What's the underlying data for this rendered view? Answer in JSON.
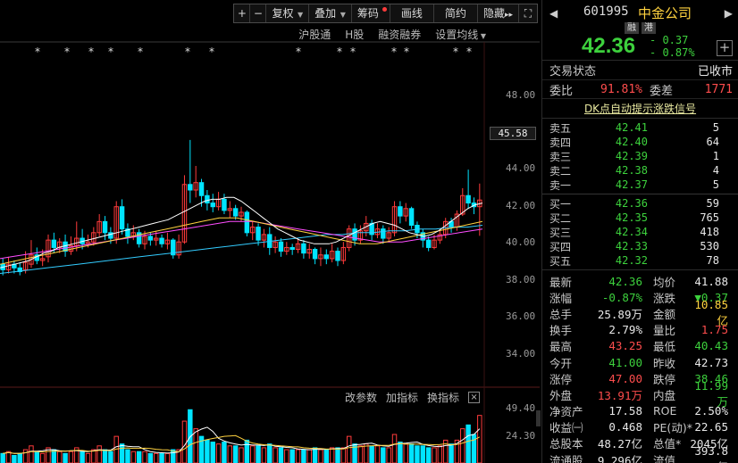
{
  "toolbar": {
    "plus": "+",
    "minus": "−",
    "fuquan": "复权",
    "diejia": "叠加",
    "chouma": "筹码",
    "huaxian": "画线",
    "jianyue": "简约",
    "yincang": "隐藏",
    "yincang_arrow": "▸▸",
    "fullscreen_icon": "⛶"
  },
  "subbar": {
    "hugutong": "沪股通",
    "hgu": "H股",
    "rongzi": "融资融券",
    "settings": "设置均线"
  },
  "price_axis": [
    "48.00",
    "45.58",
    "44.00",
    "42.00",
    "40.00",
    "38.00",
    "36.00",
    "34.00"
  ],
  "volume_axis": [
    "49.40",
    "24.30"
  ],
  "current_price_tag": "45.58",
  "indicator_bar": {
    "change_params": "改参数",
    "add_indicator": "加指标",
    "switch_indicator": "换指标",
    "close_icon": "×"
  },
  "colors": {
    "up": "#ff3b3b",
    "down": "#00e4ff",
    "ma5": "#ffffff",
    "ma10": "#ffd23f",
    "ma20": "#ff4dff",
    "ma30": "#33dd33",
    "ma60": "#33ccff",
    "ma120": "#aaaaaa"
  },
  "chart_data": {
    "type": "candlestick",
    "ylim": [
      33.5,
      49.5
    ],
    "candles": [
      [
        38.9,
        38.6,
        39.2,
        38.3
      ],
      [
        38.6,
        38.9,
        39.3,
        38.4
      ],
      [
        38.9,
        38.7,
        39.1,
        38.4
      ],
      [
        38.7,
        38.5,
        39.0,
        38.3
      ],
      [
        38.6,
        39.0,
        39.6,
        38.4
      ],
      [
        38.9,
        39.4,
        40.2,
        38.7
      ],
      [
        39.4,
        39.1,
        39.8,
        38.9
      ],
      [
        39.1,
        39.2,
        39.7,
        38.8
      ],
      [
        39.3,
        40.2,
        40.5,
        39.0
      ],
      [
        40.2,
        39.8,
        40.6,
        39.5
      ],
      [
        39.8,
        40.1,
        40.3,
        39.5
      ],
      [
        40.1,
        39.6,
        40.5,
        39.3
      ],
      [
        39.6,
        39.9,
        40.4,
        39.4
      ],
      [
        39.9,
        40.3,
        41.2,
        39.6
      ],
      [
        40.3,
        40.0,
        40.8,
        39.7
      ],
      [
        40.0,
        40.1,
        40.5,
        39.8
      ],
      [
        40.1,
        40.6,
        40.9,
        39.9
      ],
      [
        40.6,
        41.2,
        41.6,
        40.4
      ],
      [
        41.2,
        40.6,
        41.5,
        40.2
      ],
      [
        40.6,
        40.3,
        40.9,
        40.0
      ],
      [
        40.3,
        42.0,
        42.3,
        40.0
      ],
      [
        42.0,
        40.8,
        42.4,
        40.5
      ],
      [
        40.8,
        40.4,
        41.1,
        40.0
      ],
      [
        40.4,
        40.6,
        41.0,
        40.2
      ],
      [
        40.6,
        40.0,
        40.8,
        39.8
      ],
      [
        40.0,
        40.4,
        40.7,
        39.7
      ],
      [
        40.4,
        40.2,
        40.6,
        39.9
      ],
      [
        40.2,
        40.3,
        40.7,
        39.9
      ],
      [
        40.3,
        40.0,
        40.5,
        39.8
      ],
      [
        40.0,
        40.2,
        40.6,
        39.7
      ],
      [
        40.2,
        39.4,
        40.3,
        39.2
      ],
      [
        39.4,
        40.1,
        40.5,
        39.2
      ],
      [
        40.1,
        43.2,
        43.7,
        40.0
      ],
      [
        43.2,
        42.9,
        45.6,
        42.2
      ],
      [
        42.9,
        43.3,
        44.2,
        42.5
      ],
      [
        43.3,
        42.6,
        43.5,
        42.0
      ],
      [
        42.6,
        42.2,
        42.9,
        41.8
      ],
      [
        42.2,
        42.0,
        42.7,
        41.7
      ],
      [
        42.0,
        42.4,
        42.8,
        41.8
      ],
      [
        42.4,
        41.8,
        42.7,
        41.6
      ],
      [
        41.8,
        41.9,
        42.3,
        41.4
      ],
      [
        41.9,
        41.5,
        42.1,
        41.3
      ],
      [
        41.5,
        41.7,
        42.0,
        41.2
      ],
      [
        41.7,
        40.6,
        41.8,
        40.4
      ],
      [
        40.6,
        40.9,
        41.2,
        40.2
      ],
      [
        40.9,
        40.2,
        41.1,
        39.9
      ],
      [
        40.2,
        40.5,
        40.8,
        39.8
      ],
      [
        40.5,
        39.8,
        40.9,
        39.4
      ],
      [
        39.8,
        40.1,
        40.4,
        39.5
      ],
      [
        40.1,
        39.6,
        40.3,
        39.3
      ],
      [
        39.6,
        39.8,
        40.1,
        39.4
      ],
      [
        39.8,
        39.7,
        40.0,
        39.4
      ],
      [
        39.7,
        40.0,
        40.3,
        39.5
      ],
      [
        40.0,
        39.5,
        40.2,
        39.2
      ],
      [
        39.5,
        39.7,
        40.0,
        39.2
      ],
      [
        39.7,
        39.2,
        39.8,
        38.9
      ],
      [
        39.2,
        39.4,
        39.8,
        38.8
      ],
      [
        39.4,
        39.2,
        39.7,
        38.9
      ],
      [
        39.2,
        39.6,
        40.0,
        39.0
      ],
      [
        39.6,
        39.1,
        39.8,
        38.8
      ],
      [
        39.1,
        39.8,
        40.1,
        38.9
      ],
      [
        39.8,
        40.8,
        41.0,
        39.6
      ],
      [
        40.8,
        40.2,
        41.1,
        39.9
      ],
      [
        40.2,
        40.7,
        41.0,
        40.0
      ],
      [
        40.7,
        41.1,
        41.5,
        40.4
      ],
      [
        41.1,
        40.5,
        41.3,
        40.2
      ],
      [
        40.5,
        40.8,
        41.1,
        40.3
      ],
      [
        40.8,
        40.3,
        41.0,
        40.0
      ],
      [
        40.3,
        40.6,
        40.9,
        40.1
      ],
      [
        40.6,
        42.0,
        42.3,
        40.4
      ],
      [
        42.0,
        41.5,
        42.3,
        41.1
      ],
      [
        41.5,
        41.9,
        42.2,
        41.2
      ],
      [
        41.9,
        41.0,
        42.0,
        40.8
      ],
      [
        41.0,
        40.6,
        41.2,
        40.3
      ],
      [
        40.6,
        40.2,
        40.8,
        39.8
      ],
      [
        40.2,
        39.8,
        40.4,
        39.6
      ],
      [
        39.8,
        40.2,
        40.5,
        39.7
      ],
      [
        40.2,
        40.5,
        40.8,
        40.0
      ],
      [
        40.5,
        41.2,
        41.4,
        40.3
      ],
      [
        41.2,
        40.9,
        41.4,
        40.6
      ],
      [
        40.9,
        41.6,
        41.8,
        40.7
      ],
      [
        41.6,
        42.6,
        43.0,
        41.5
      ],
      [
        42.6,
        42.2,
        44.0,
        41.9
      ],
      [
        42.2,
        42.0,
        42.5,
        41.6
      ],
      [
        42.0,
        42.36,
        43.25,
        40.43
      ]
    ],
    "ma5": [
      38.7,
      38.8,
      38.9,
      39.0,
      39.1,
      39.3,
      39.5,
      39.6,
      39.8,
      39.9,
      40.0,
      40.1,
      40.2,
      40.3,
      40.4,
      40.5,
      40.6,
      40.7,
      40.8,
      40.9,
      41.0,
      41.1,
      41.2,
      41.3,
      41.5,
      41.7,
      41.9,
      42.1,
      42.3,
      42.4,
      42.4,
      42.5,
      42.5,
      42.3,
      42.0,
      41.7,
      41.4,
      41.1,
      40.8,
      40.6,
      40.4,
      40.2,
      40.1,
      40.0,
      40.0,
      40.0,
      40.1,
      40.3,
      40.5,
      40.7,
      40.9,
      41.1,
      41.2,
      41.1,
      41.0,
      40.8,
      40.6,
      40.5,
      40.4,
      40.5,
      40.7,
      41.0,
      41.3,
      41.6,
      41.9,
      42.1,
      42.2
    ],
    "ma10": [
      38.9,
      39.0,
      39.1,
      39.2,
      39.3,
      39.4,
      39.5,
      39.6,
      39.7,
      39.8,
      39.9,
      40.0,
      40.1,
      40.2,
      40.3,
      40.4,
      40.5,
      40.6,
      40.7,
      40.8,
      40.9,
      41.0,
      41.1,
      41.2,
      41.3,
      41.4,
      41.4,
      41.4,
      41.3,
      41.2,
      41.1,
      41.0,
      40.9,
      40.8,
      40.7,
      40.6,
      40.5,
      40.4,
      40.3,
      40.2,
      40.1,
      40.0,
      40.0,
      40.0,
      40.1,
      40.2,
      40.3,
      40.4,
      40.5,
      40.6,
      40.7,
      40.8,
      40.9,
      41.0,
      41.1,
      41.2
    ],
    "ma20": [
      39.2,
      39.3,
      39.4,
      39.5,
      39.6,
      39.7,
      39.8,
      39.9,
      40.0,
      40.1,
      40.2,
      40.3,
      40.4,
      40.5,
      40.6,
      40.7,
      40.8,
      40.9,
      41.0,
      41.1,
      41.2,
      41.2,
      41.2,
      41.1,
      41.0,
      40.9,
      40.8,
      40.7,
      40.6,
      40.5,
      40.4,
      40.3,
      40.2,
      40.1,
      40.1,
      40.1,
      40.2,
      40.3,
      40.4,
      40.5,
      40.6,
      40.7,
      40.8
    ],
    "ma60": [
      38.4,
      38.5,
      38.6,
      38.7,
      38.8,
      38.9,
      39.0,
      39.1,
      39.2,
      39.3,
      39.4,
      39.5,
      39.6,
      39.7,
      39.8,
      39.9,
      40.0,
      40.1,
      40.2,
      40.3,
      40.4,
      40.5,
      40.5,
      40.6,
      40.6,
      40.7,
      40.7,
      40.8,
      40.8,
      40.9,
      40.9,
      41.0
    ],
    "volume": [
      5,
      6,
      4,
      5,
      7,
      9,
      6,
      5,
      8,
      7,
      6,
      5,
      6,
      8,
      6,
      5,
      7,
      9,
      7,
      6,
      14,
      10,
      7,
      6,
      6,
      6,
      5,
      5,
      5,
      5,
      7,
      7,
      22,
      28,
      18,
      14,
      12,
      11,
      10,
      11,
      9,
      9,
      8,
      12,
      9,
      9,
      8,
      10,
      8,
      8,
      7,
      7,
      7,
      7,
      7,
      8,
      7,
      7,
      8,
      8,
      8,
      14,
      10,
      9,
      10,
      9,
      9,
      8,
      8,
      15,
      11,
      10,
      10,
      9,
      9,
      8,
      8,
      9,
      12,
      10,
      12,
      18,
      20,
      15,
      25
    ],
    "markers": [
      "*",
      "*",
      "*",
      "*",
      "*",
      "*",
      "*",
      "*",
      "*",
      "*",
      "*",
      "*",
      "*",
      "*"
    ]
  },
  "stock": {
    "code": "601995",
    "name": "中金公司",
    "badge_rong": "融",
    "badge_gang": "港",
    "price": "42.36",
    "change": "- 0.37",
    "change_pct": "- 0.87%",
    "add_icon": "+",
    "nav_left": "◀",
    "nav_right": "▶"
  },
  "status": {
    "label": "交易状态",
    "value": "已收市"
  },
  "weibi": {
    "label": "委比",
    "value": "91.81%",
    "label2": "委差",
    "value2": "1771"
  },
  "dk_link": "DK点自动提示涨跌信号",
  "sell_orders": [
    {
      "label": "卖五",
      "price": "42.41",
      "vol": "5"
    },
    {
      "label": "卖四",
      "price": "42.40",
      "vol": "64"
    },
    {
      "label": "卖三",
      "price": "42.39",
      "vol": "1"
    },
    {
      "label": "卖二",
      "price": "42.38",
      "vol": "4"
    },
    {
      "label": "卖一",
      "price": "42.37",
      "vol": "5"
    }
  ],
  "buy_orders": [
    {
      "label": "买一",
      "price": "42.36",
      "vol": "59"
    },
    {
      "label": "买二",
      "price": "42.35",
      "vol": "765"
    },
    {
      "label": "买三",
      "price": "42.34",
      "vol": "418"
    },
    {
      "label": "买四",
      "price": "42.33",
      "vol": "530"
    },
    {
      "label": "买五",
      "price": "42.32",
      "vol": "78"
    }
  ],
  "quote": [
    {
      "k1": "最新",
      "v1": "42.36",
      "c1": "green",
      "k2": "均价",
      "v2": "41.88",
      "c2": "white"
    },
    {
      "k1": "涨幅",
      "v1": "-0.87%",
      "c1": "green",
      "k2": "涨跌",
      "v2": "▼0.37",
      "c2": "green"
    },
    {
      "k1": "总手",
      "v1": "25.89万",
      "c1": "white",
      "k2": "金额",
      "v2": "10.85亿",
      "c2": "yellow"
    },
    {
      "k1": "换手",
      "v1": "2.79%",
      "c1": "white",
      "k2": "量比",
      "v2": "1.75",
      "c2": "red"
    },
    {
      "k1": "最高",
      "v1": "43.25",
      "c1": "red",
      "k2": "最低",
      "v2": "40.43",
      "c2": "green"
    },
    {
      "k1": "今开",
      "v1": "41.00",
      "c1": "green",
      "k2": "昨收",
      "v2": "42.73",
      "c2": "white"
    },
    {
      "k1": "涨停",
      "v1": "47.00",
      "c1": "red",
      "k2": "跌停",
      "v2": "38.46",
      "c2": "green"
    },
    {
      "k1": "外盘",
      "v1": "13.91万",
      "c1": "red",
      "k2": "内盘",
      "v2": "11.99万",
      "c2": "green"
    },
    {
      "k1": "净资产",
      "v1": "17.58",
      "c1": "white",
      "k2": "ROE",
      "v2": "2.50%",
      "c2": "white"
    },
    {
      "k1": "收益㈠",
      "v1": "0.468",
      "c1": "white",
      "k2": "PE(动)*",
      "v2": "22.65",
      "c2": "white"
    },
    {
      "k1": "总股本",
      "v1": "48.27亿",
      "c1": "white",
      "k2": "总值*",
      "v2": "2045亿",
      "c2": "white"
    },
    {
      "k1": "流通股",
      "v1": "9.296亿",
      "c1": "white",
      "k2": "流值",
      "v2": "393.8亿",
      "c2": "white"
    }
  ]
}
